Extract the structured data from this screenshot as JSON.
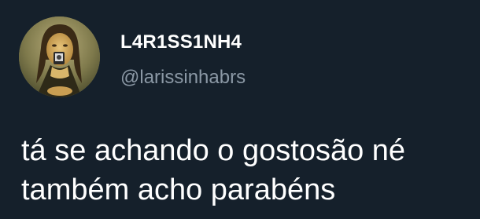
{
  "tweet": {
    "author": {
      "display_name": "L4R1SS1NH4",
      "handle": "@larissinhabrs",
      "avatar_icon": "mona-lisa-avatar"
    },
    "text": "tá se achando o gostosão né\ntambém acho parabéns"
  },
  "colors": {
    "background": "#15202b",
    "display_name": "#ffffff",
    "handle": "#8b98a5",
    "text": "#ffffff"
  }
}
